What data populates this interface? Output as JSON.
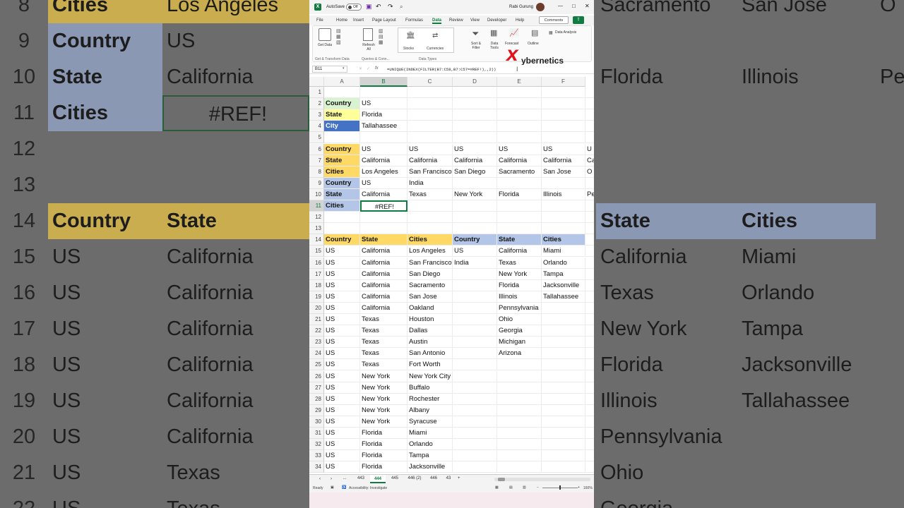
{
  "background_zoom": {
    "row_numbers": [
      "8",
      "9",
      "10",
      "11",
      "12",
      "13",
      "14",
      "15",
      "16",
      "17",
      "18",
      "19",
      "20",
      "21",
      "22"
    ],
    "left_col_a": [
      "Cities",
      "Country",
      "State",
      "Cities",
      "",
      "",
      "Country",
      "US",
      "US",
      "US",
      "US",
      "US",
      "US",
      "US",
      "US"
    ],
    "left_col_b": [
      "Los Angeles",
      "US",
      "California",
      "#REF!",
      "",
      "",
      "State",
      "California",
      "California",
      "California",
      "California",
      "California",
      "California",
      "Texas",
      "Texas"
    ],
    "right_col_e": [
      "Sacramento",
      "",
      "Florida",
      "",
      "",
      "",
      "State",
      "California",
      "Texas",
      "New York",
      "Florida",
      "Illinois",
      "Pennsylvania",
      "Ohio",
      "Georgia"
    ],
    "right_col_f": [
      "San Jose",
      "",
      "Illinois",
      "",
      "",
      "",
      "Cities",
      "Miami",
      "Orlando",
      "Tampa",
      "Jacksonville",
      "Tallahassee",
      "",
      "",
      ""
    ],
    "right_col_g": [
      "O",
      "",
      "Pe",
      "",
      "",
      "",
      "",
      "",
      "",
      "",
      "",
      "",
      "",
      "",
      ""
    ]
  },
  "window": {
    "autosave_label": "AutoSave",
    "autosave_state": "Off",
    "user_name": "Rabi Gurung",
    "minimize": "—",
    "maximize": "□",
    "close": "✕"
  },
  "menu": [
    "File",
    "Home",
    "Insert",
    "Page Layout",
    "Formulas",
    "Data",
    "Review",
    "View",
    "Developer",
    "Help"
  ],
  "menu_active": "Data",
  "comments_label": "Comments",
  "ribbon": {
    "get_data": "Get Data",
    "refresh_all": "Refresh All",
    "stocks": "Stocks",
    "currencies": "Currencies",
    "sort_filter": "Sort & Filter",
    "data_tools": "Data Tools",
    "forecast": "Forecast",
    "outline": "Outline",
    "data_analysis": "Data Analysis",
    "group1": "Get & Transform Data",
    "group2": "Queries & Conn...",
    "group3": "Data Types"
  },
  "watermark": {
    "x": "x",
    "text": "ybernetics"
  },
  "formula_bar": {
    "name_box": "B11",
    "fx": "fx",
    "formula": "=UNIQUE(INDEX(FILTER(B7:C58,B7:C57=#REF!),,2))"
  },
  "columns": [
    "A",
    "B",
    "C",
    "D",
    "E",
    "F"
  ],
  "rows": [
    {
      "n": "1",
      "cells": [
        "",
        "",
        "",
        "",
        "",
        "",
        ""
      ]
    },
    {
      "n": "2",
      "cells": [
        "Country",
        "US",
        "",
        "",
        "",
        "",
        ""
      ]
    },
    {
      "n": "3",
      "cells": [
        "State",
        "Florida",
        "",
        "",
        "",
        "",
        ""
      ]
    },
    {
      "n": "4",
      "cells": [
        "City",
        "Tallahassee",
        "",
        "",
        "",
        "",
        ""
      ]
    },
    {
      "n": "5",
      "cells": [
        "",
        "",
        "",
        "",
        "",
        "",
        ""
      ]
    },
    {
      "n": "6",
      "cells": [
        "Country",
        "US",
        "US",
        "US",
        "US",
        "US",
        "U"
      ]
    },
    {
      "n": "7",
      "cells": [
        "State",
        "California",
        "California",
        "California",
        "California",
        "California",
        "Ca"
      ]
    },
    {
      "n": "8",
      "cells": [
        "Cities",
        "Los Angeles",
        "San Francisco",
        "San Diego",
        "Sacramento",
        "San Jose",
        "O"
      ]
    },
    {
      "n": "9",
      "cells": [
        "Country",
        "US",
        "India",
        "",
        "",
        "",
        ""
      ]
    },
    {
      "n": "10",
      "cells": [
        "State",
        "California",
        "Texas",
        "New York",
        "Florida",
        "Illinois",
        "Pe"
      ]
    },
    {
      "n": "11",
      "cells": [
        "Cities",
        "#REF!",
        "",
        "",
        "",
        "",
        ""
      ]
    },
    {
      "n": "12",
      "cells": [
        "",
        "",
        "",
        "",
        "",
        "",
        ""
      ]
    },
    {
      "n": "13",
      "cells": [
        "",
        "",
        "",
        "",
        "",
        "",
        ""
      ]
    },
    {
      "n": "14",
      "cells": [
        "Country",
        "State",
        "Cities",
        "Country",
        "State",
        "Cities",
        ""
      ]
    },
    {
      "n": "15",
      "cells": [
        "US",
        "California",
        "Los Angeles",
        "US",
        "California",
        "Miami",
        ""
      ]
    },
    {
      "n": "16",
      "cells": [
        "US",
        "California",
        "San Francisco",
        "India",
        "Texas",
        "Orlando",
        ""
      ]
    },
    {
      "n": "17",
      "cells": [
        "US",
        "California",
        "San Diego",
        "",
        "New York",
        "Tampa",
        ""
      ]
    },
    {
      "n": "18",
      "cells": [
        "US",
        "California",
        "Sacramento",
        "",
        "Florida",
        "Jacksonville",
        ""
      ]
    },
    {
      "n": "19",
      "cells": [
        "US",
        "California",
        "San Jose",
        "",
        "Illinois",
        "Tallahassee",
        ""
      ]
    },
    {
      "n": "20",
      "cells": [
        "US",
        "California",
        "Oakland",
        "",
        "Pennsylvania",
        "",
        ""
      ]
    },
    {
      "n": "21",
      "cells": [
        "US",
        "Texas",
        "Houston",
        "",
        "Ohio",
        "",
        ""
      ]
    },
    {
      "n": "22",
      "cells": [
        "US",
        "Texas",
        "Dallas",
        "",
        "Georgia",
        "",
        ""
      ]
    },
    {
      "n": "23",
      "cells": [
        "US",
        "Texas",
        "Austin",
        "",
        "Michigan",
        "",
        ""
      ]
    },
    {
      "n": "24",
      "cells": [
        "US",
        "Texas",
        "San Antonio",
        "",
        "Arizona",
        "",
        ""
      ]
    },
    {
      "n": "25",
      "cells": [
        "US",
        "Texas",
        "Fort Worth",
        "",
        "",
        "",
        ""
      ]
    },
    {
      "n": "26",
      "cells": [
        "US",
        "New York",
        "New York City",
        "",
        "",
        "",
        ""
      ]
    },
    {
      "n": "27",
      "cells": [
        "US",
        "New York",
        "Buffalo",
        "",
        "",
        "",
        ""
      ]
    },
    {
      "n": "28",
      "cells": [
        "US",
        "New York",
        "Rochester",
        "",
        "",
        "",
        ""
      ]
    },
    {
      "n": "29",
      "cells": [
        "US",
        "New York",
        "Albany",
        "",
        "",
        "",
        ""
      ]
    },
    {
      "n": "30",
      "cells": [
        "US",
        "New York",
        "Syracuse",
        "",
        "",
        "",
        ""
      ]
    },
    {
      "n": "31",
      "cells": [
        "US",
        "Florida",
        "Miami",
        "",
        "",
        "",
        ""
      ]
    },
    {
      "n": "32",
      "cells": [
        "US",
        "Florida",
        "Orlando",
        "",
        "",
        "",
        ""
      ]
    },
    {
      "n": "33",
      "cells": [
        "US",
        "Florida",
        "Tampa",
        "",
        "",
        "",
        ""
      ]
    },
    {
      "n": "34",
      "cells": [
        "US",
        "Florida",
        "Jacksonville",
        "",
        "",
        "",
        ""
      ]
    }
  ],
  "sheet_tabs": [
    "...",
    "443",
    "444",
    "445",
    "446 (2)",
    "446",
    "43"
  ],
  "active_sheet": "444",
  "add_sheet": "+",
  "status": {
    "ready": "Ready",
    "accessibility": "Accessibility: Investigate",
    "zoom": "160%"
  },
  "colors": {
    "green_fill": "#d9f2d0",
    "yellow_fill": "#ffff99",
    "blue_fill": "#4472c4",
    "gold_fill": "#ffd966",
    "lavender_fill": "#b4c6e7",
    "excel_green": "#107c41"
  }
}
